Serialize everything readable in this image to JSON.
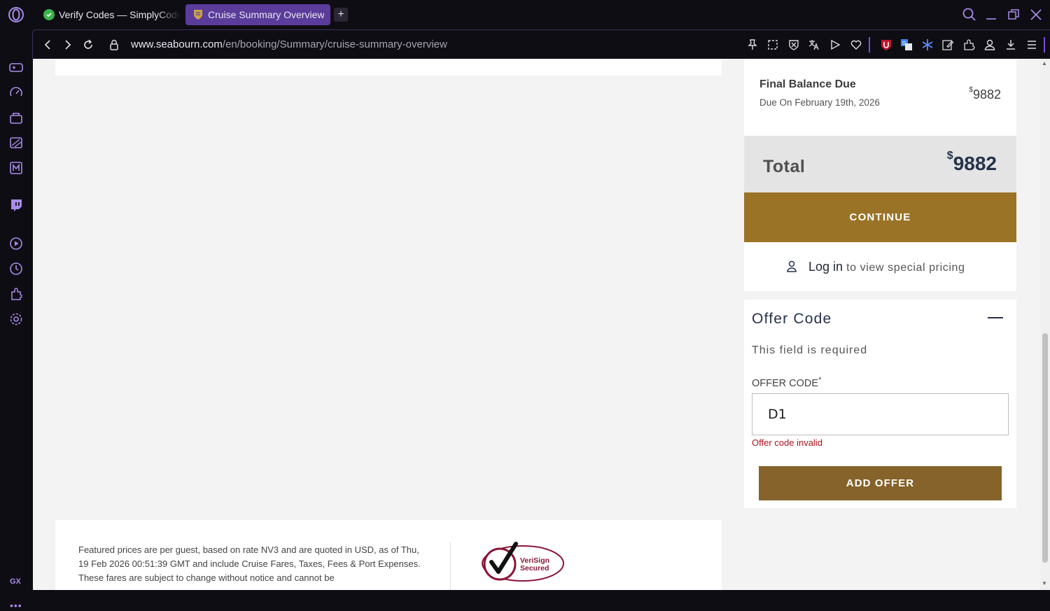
{
  "browser": {
    "tabs": [
      {
        "label": "Verify Codes — SimplyCodes",
        "active": false
      },
      {
        "label": "Cruise Summary Overview",
        "active": true
      }
    ],
    "url_host": "www.seabourn.com",
    "url_path": "/en/booking/Summary/cruise-summary-overview",
    "sidebar_gx_label": "GX",
    "sidebar_more": "•••",
    "new_tab_symbol": "+"
  },
  "summary": {
    "final_balance_title": "Final Balance Due",
    "final_balance_due_date": "Due On February 19th, 2026",
    "currency_symbol": "$",
    "final_balance_amount": "9882",
    "total_label": "Total",
    "total_amount": "9882",
    "continue_label": "CONTINUE",
    "login_link": "Log in",
    "login_suffix": " to view special pricing"
  },
  "offer": {
    "title": "Offer Code",
    "required_message": "This field is required",
    "field_label": "OFFER CODE",
    "required_marker": "*",
    "value": "D1",
    "error": "Offer code invalid",
    "add_label": "ADD OFFER"
  },
  "footer": {
    "disclaimer": "Featured prices are per guest, based on rate NV3 and are quoted in USD, as of Thu, 19 Feb 2026 00:51:39 GMT and include Cruise Fares, Taxes, Fees & Port Expenses. These fares are subject to change without notice and cannot be",
    "seal_line1": "VeriSign",
    "seal_line2": "Secured"
  },
  "colors": {
    "gold": "#9a7326",
    "gold_dark": "#86632a",
    "navy": "#25324a",
    "error": "#b1101c",
    "accent_purple": "#5b3c9b"
  },
  "icons": [
    "opera-logo-icon",
    "shield-icon",
    "search-icon",
    "minimize-icon",
    "restore-icon",
    "close-icon",
    "back-icon",
    "forward-icon",
    "reload-icon",
    "lock-icon",
    "pin-icon",
    "snapshot-icon",
    "adblock-icon",
    "translate-icon",
    "player-icon",
    "heart-icon",
    "ublock-icon",
    "google-translate-icon",
    "snowflake-icon",
    "edit-icon",
    "extensions-icon",
    "profile-icon",
    "download-icon",
    "menu-icon",
    "user-icon"
  ]
}
